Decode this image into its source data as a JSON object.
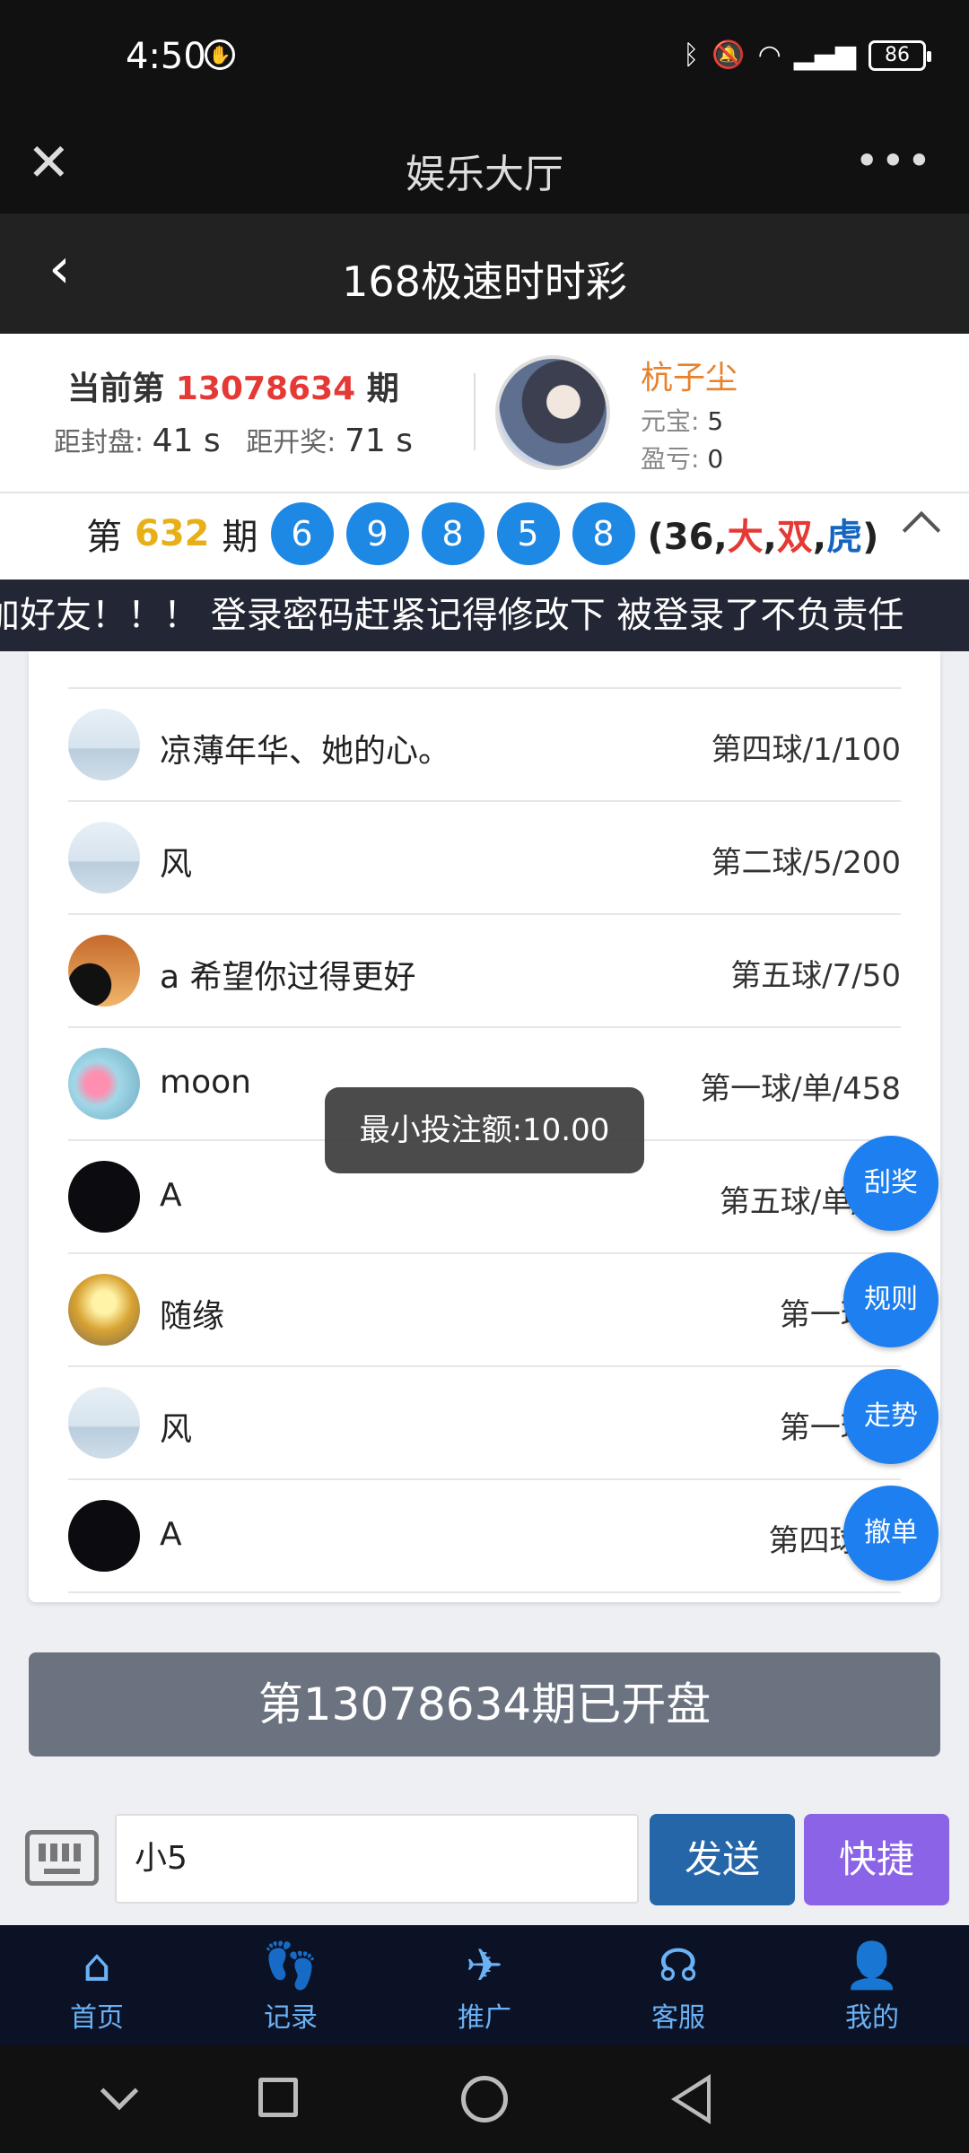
{
  "status_bar": {
    "time": "4:50",
    "battery": "86"
  },
  "app_bar": {
    "title": "娱乐大厅"
  },
  "sub_bar": {
    "title": "168极速时时彩"
  },
  "info": {
    "period_prefix": "当前第",
    "period_number": "13078634",
    "period_suffix": "期",
    "close_label": "距封盘:",
    "close_value": "41 s",
    "open_label": "距开奖:",
    "open_value": "71 s",
    "username": "杭子尘",
    "balance_label": "元宝:",
    "balance_value": "5",
    "profit_label": "盈亏:",
    "profit_value": "0"
  },
  "result": {
    "prefix": "第",
    "period": "632",
    "suffix": "期",
    "balls": [
      "6",
      "9",
      "8",
      "5",
      "8"
    ],
    "sum": "36",
    "size": "大",
    "parity": "双",
    "dragon_tiger": "虎",
    "colors": {
      "ball": "#1e88e5",
      "size": "#e53935",
      "parity": "#e53935",
      "dragon_tiger": "#1565c0"
    }
  },
  "marquee": {
    "text": "加好友！！！  登录密码赶紧记得修改下 被登录了不负责任"
  },
  "bets": [
    {
      "name": "凉薄年华、她的心。",
      "bet": "第四球/1/100",
      "avatar": "placeholder"
    },
    {
      "name": "风",
      "bet": "第二球/5/200",
      "avatar": "placeholder"
    },
    {
      "name": "a 希望你过得更好",
      "bet": "第五球/7/50",
      "avatar": "sunset"
    },
    {
      "name": "moon",
      "bet": "第一球/单/458",
      "avatar": "moon"
    },
    {
      "name": "A",
      "bet": "第五球/单/20",
      "avatar": "dark"
    },
    {
      "name": "随缘",
      "bet": "第一球/5",
      "avatar": "sunny"
    },
    {
      "name": "风",
      "bet": "第一球/7",
      "avatar": "placeholder"
    },
    {
      "name": "A",
      "bet": "第四球/小",
      "avatar": "dark"
    }
  ],
  "toast": "最小投注额:10.00",
  "fabs": [
    "刮奖",
    "规则",
    "走势",
    "撤单"
  ],
  "opened_banner": "第13078634期已开盘",
  "input": {
    "value": "小5"
  },
  "buttons": {
    "send": "发送",
    "quick": "快捷"
  },
  "nav": [
    {
      "label": "首页",
      "icon": "home-icon"
    },
    {
      "label": "记录",
      "icon": "footprint-icon"
    },
    {
      "label": "推广",
      "icon": "paper-plane-icon"
    },
    {
      "label": "客服",
      "icon": "headset-icon"
    },
    {
      "label": "我的",
      "icon": "user-icon"
    }
  ]
}
